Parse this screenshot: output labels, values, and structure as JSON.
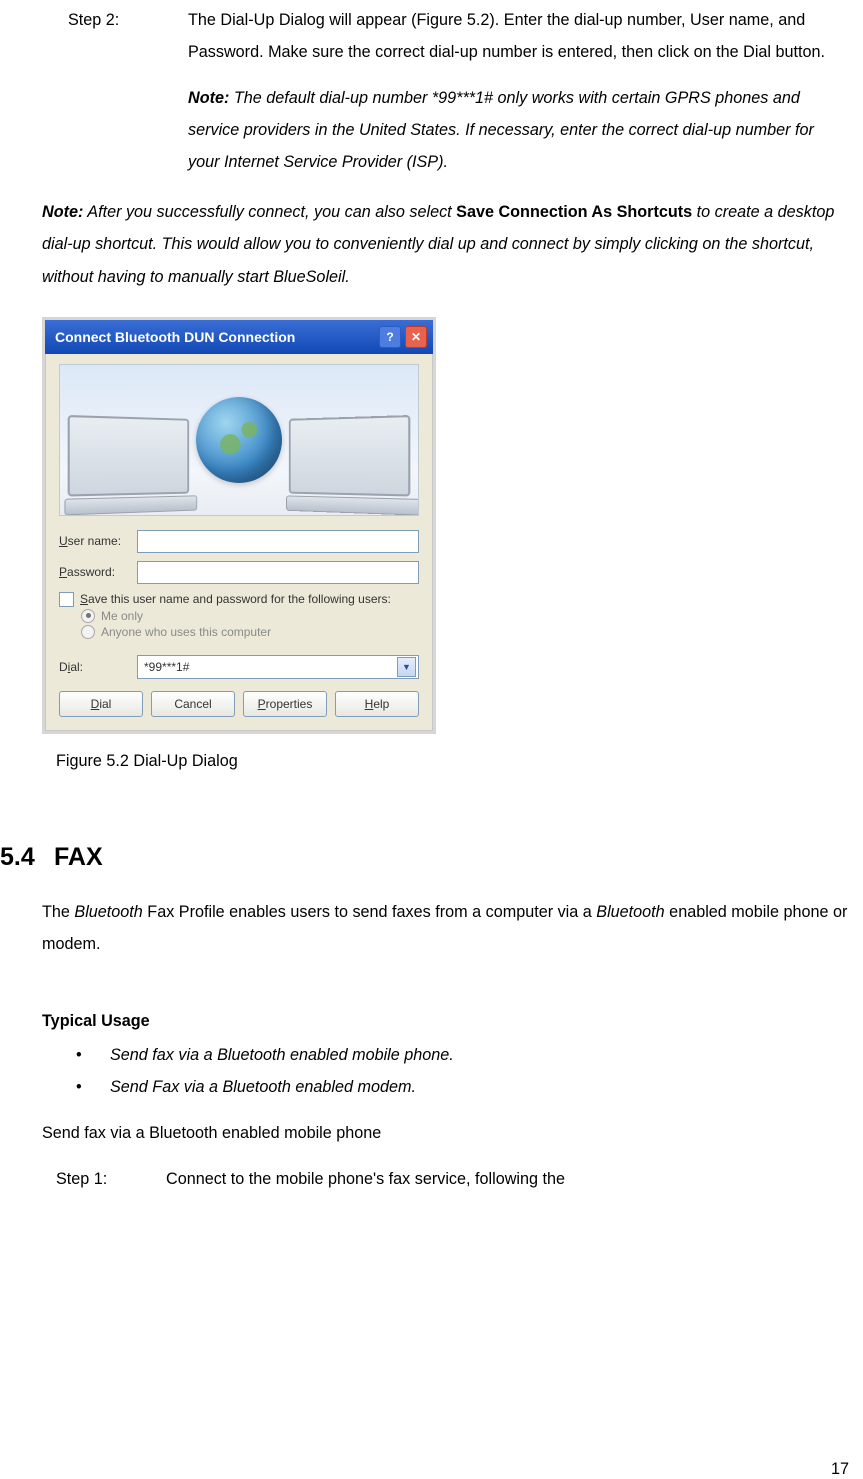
{
  "step2": {
    "label": "Step 2:",
    "text": "The Dial-Up Dialog will appear (Figure 5.2). Enter the dial-up number, User name, and Password. Make sure the correct dial-up number is entered, then click on the Dial button."
  },
  "note_inner": {
    "label": "Note:",
    "text": " The default dial-up number *99***1# only works with certain GPRS phones and service providers in the United States. If necessary, enter the correct dial-up number for your Internet Service Provider (ISP)."
  },
  "note_outer": {
    "label": "Note:",
    "pre": " After you successfully connect, you can also select ",
    "strong": "Save Connection As Shortcuts",
    "post": " to create a desktop dial-up shortcut. This would allow you to conveniently dial up and connect by simply clicking on the shortcut, without having to manually start BlueSoleil."
  },
  "dialog": {
    "title": "Connect Bluetooth DUN Connection",
    "help_icon": "?",
    "close_icon": "✕",
    "username_label_pre": "U",
    "username_label_post": "ser name:",
    "password_label_pre": "P",
    "password_label_post": "assword:",
    "save_pre": "S",
    "save_post": "ave this user name and password for the following users:",
    "radio_me": "Me only",
    "radio_anyone": "Anyone who uses this computer",
    "dial_label_pre": "D",
    "dial_label_mid": "i",
    "dial_label_post": "al:",
    "dial_value": "*99***1#",
    "btn_dial_pre": "D",
    "btn_dial_post": "ial",
    "btn_cancel": "Cancel",
    "btn_properties_pre": "P",
    "btn_properties_post": "roperties",
    "btn_help_pre": "H",
    "btn_help_post": "elp"
  },
  "figure_caption": "Figure 5.2 Dial-Up Dialog",
  "section": {
    "num": "5.4",
    "title": "FAX"
  },
  "fax_intro": {
    "pre": "The ",
    "it1": "Bluetooth",
    "mid": " Fax Profile enables users to send faxes from a computer via a ",
    "it2": "Bluetooth",
    "post": " enabled mobile phone or modem."
  },
  "typical_usage_head": "Typical Usage",
  "bullets": {
    "b1": "Send fax via a Bluetooth enabled mobile phone.",
    "b2": "Send Fax via a Bluetooth enabled modem."
  },
  "send_fax_line": "Send fax via a Bluetooth enabled mobile phone",
  "step1": {
    "label": "Step 1:",
    "text": "Connect to the mobile phone's fax service, following the"
  },
  "page_number": "17"
}
